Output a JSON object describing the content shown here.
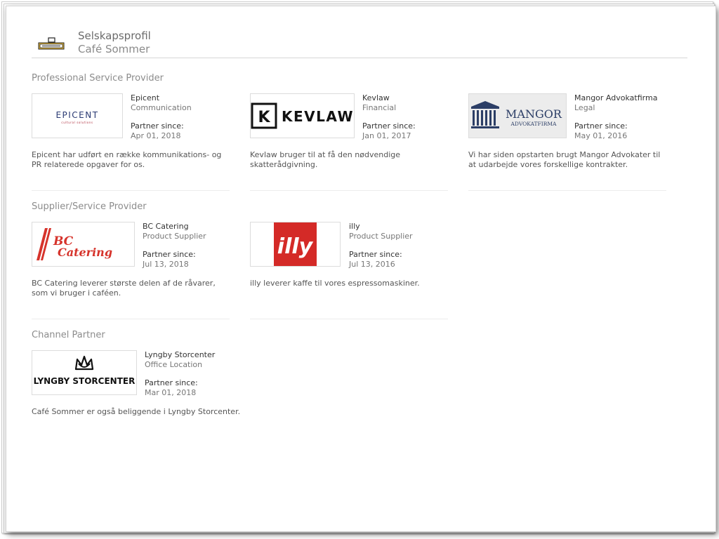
{
  "header": {
    "title": "Selskapsprofil",
    "subtitle": "Café Sommer",
    "logo_icon": "cafe-sommer-logo"
  },
  "sections": [
    {
      "title": "Professional Service Provider",
      "partners": [
        {
          "name": "Epicent",
          "type": "Communication",
          "since_label": "Partner since:",
          "since": "Apr 01, 2018",
          "description": "Epicent har udført en række kommunikations- og PR relaterede opgaver for os.",
          "logo": {
            "text": "EPICENT",
            "tagline": "cultural solutions"
          }
        },
        {
          "name": "Kevlaw",
          "type": "Financial",
          "since_label": "Partner since:",
          "since": "Jan 01, 2017",
          "description": "Kevlaw bruger til at få den nødvendige skatterådgivning.",
          "logo": {
            "text": "KEVLAW",
            "mark": "K"
          }
        },
        {
          "name": "Mangor Advokatfirma",
          "type": "Legal",
          "since_label": "Partner since:",
          "since": "May 01, 2016",
          "description": "Vi har siden opstarten brugt Mangor Advokater til at udarbejde vores forskellige kontrakter.",
          "logo": {
            "text": "MANGOR",
            "sub": "ADVOKATFIRMA"
          }
        }
      ]
    },
    {
      "title": "Supplier/Service Provider",
      "partners": [
        {
          "name": "BC Catering",
          "type": "Product Supplier",
          "since_label": "Partner since:",
          "since": "Jul 13, 2018",
          "description": "BC Catering leverer største delen af de råvarer, som vi bruger i caféen.",
          "logo": {
            "text1": "BC",
            "text2": "Catering"
          }
        },
        {
          "name": "illy",
          "type": "Product Supplier",
          "since_label": "Partner since:",
          "since": "Jul 13, 2016",
          "description": "illy leverer kaffe til vores espressomaskiner.",
          "logo": {
            "text": "illy"
          }
        }
      ]
    },
    {
      "title": "Channel Partner",
      "partners": [
        {
          "name": "Lyngby Storcenter",
          "type": "Office Location",
          "since_label": "Partner since:",
          "since": "Mar 01, 2018",
          "description": "Café Sommer er også beliggende i Lyngby Storcenter.",
          "logo": {
            "text": "LYNGBY STORCENTER"
          }
        }
      ]
    }
  ],
  "colors": {
    "bc_red": "#d6332b",
    "illy_red": "#d42a27",
    "mangor_navy": "#2c3e66",
    "epicent_navy": "#2a3a73",
    "epicent_tagline": "#b03040"
  }
}
